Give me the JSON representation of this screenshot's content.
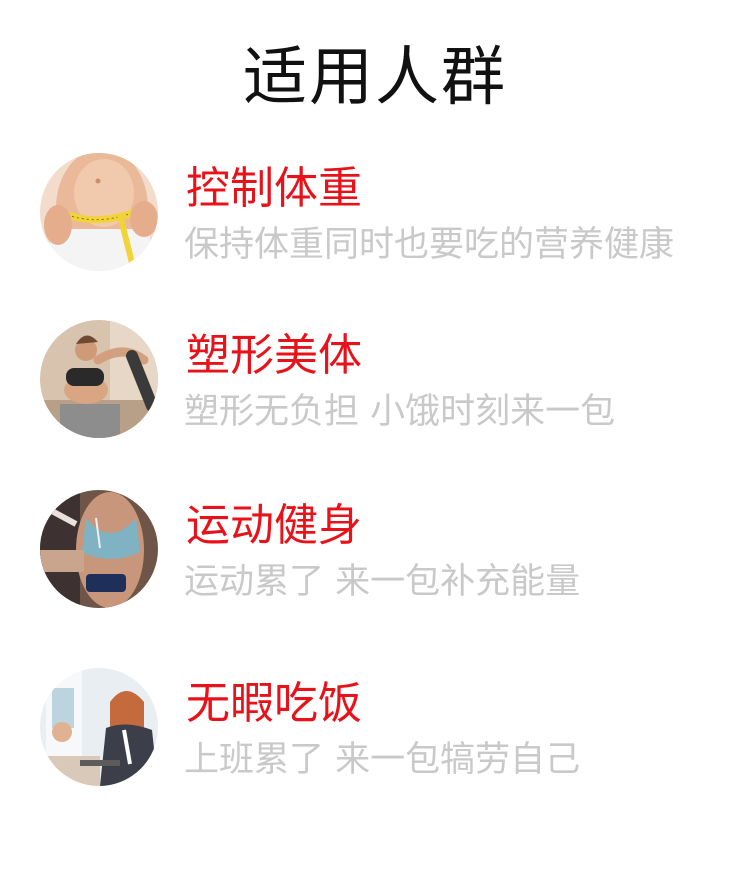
{
  "page": {
    "title": "适用人群"
  },
  "items": [
    {
      "title": "控制体重",
      "desc": "保持体重同时也要吃的营养健康",
      "image": "waist-measuring-tape-photo"
    },
    {
      "title": "塑形美体",
      "desc": "塑形无负担 小饿时刻来一包",
      "image": "yoga-stretch-photo"
    },
    {
      "title": "运动健身",
      "desc": "运动累了 来一包补充能量",
      "image": "fitness-sportswear-photo"
    },
    {
      "title": "无暇吃饭",
      "desc": "上班累了 来一包犒劳自己",
      "image": "office-workers-photo"
    }
  ],
  "colors": {
    "title": "#111111",
    "item_title": "#e8121a",
    "item_desc": "#c9c9c9",
    "background": "#ffffff"
  }
}
